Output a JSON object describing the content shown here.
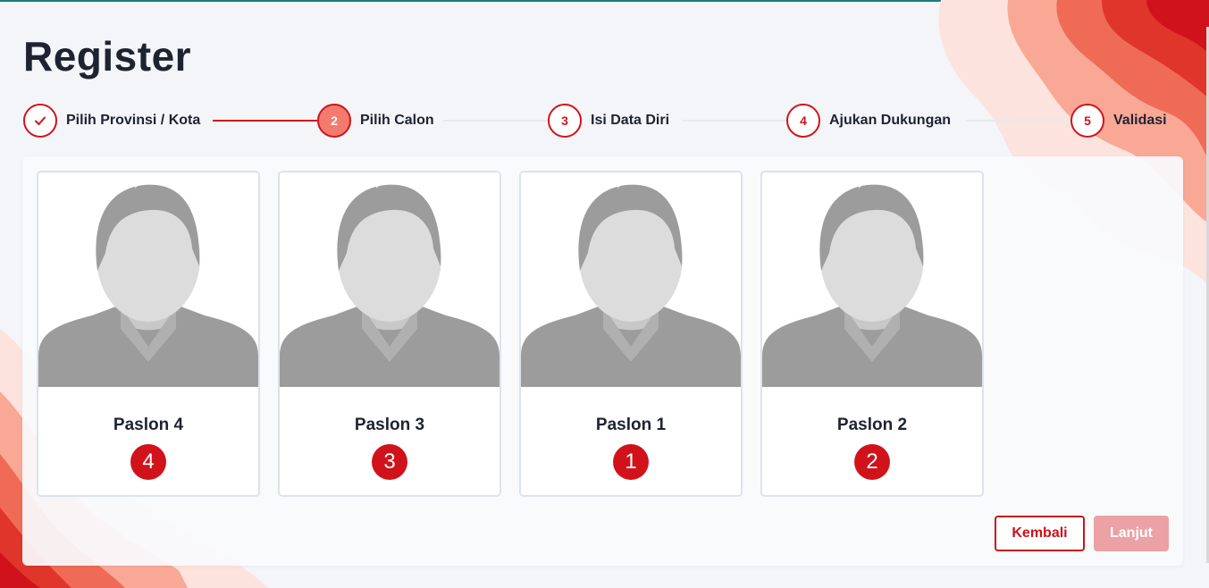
{
  "page": {
    "title": "Register"
  },
  "stepper": {
    "steps": [
      {
        "number": "",
        "label": "Pilih Provinsi / Kota",
        "state": "done",
        "icon": "check-icon"
      },
      {
        "number": "2",
        "label": "Pilih Calon",
        "state": "active"
      },
      {
        "number": "3",
        "label": "Isi Data Diri",
        "state": "pending"
      },
      {
        "number": "4",
        "label": "Ajukan Dukungan",
        "state": "pending"
      },
      {
        "number": "5",
        "label": "Validasi",
        "state": "pending"
      }
    ]
  },
  "candidates": [
    {
      "name": "Paslon 4",
      "number": "4",
      "photo": "avatar-placeholder"
    },
    {
      "name": "Paslon 3",
      "number": "3",
      "photo": "avatar-placeholder"
    },
    {
      "name": "Paslon 1",
      "number": "1",
      "photo": "avatar-placeholder"
    },
    {
      "name": "Paslon 2",
      "number": "2",
      "photo": "avatar-placeholder"
    }
  ],
  "actions": {
    "back_label": "Kembali",
    "next_label": "Lanjut"
  },
  "colors": {
    "primary": "#d0131b",
    "active_step": "#f37b6e",
    "disabled_button": "#eca1a4",
    "title": "#1e2332"
  }
}
